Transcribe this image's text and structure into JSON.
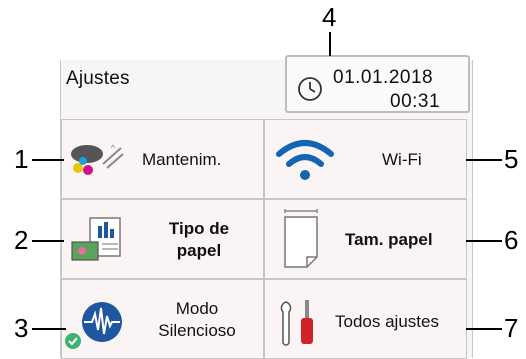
{
  "header": {
    "title": "Ajustes",
    "date": "01.01.2018",
    "time": "00:31"
  },
  "tiles": [
    {
      "label": "Mantenim.",
      "icon": "maintenance-icon"
    },
    {
      "label": "Wi-Fi",
      "icon": "wifi-icon"
    },
    {
      "label": "Tipo de papel",
      "line1": "Tipo de",
      "line2": "papel",
      "icon": "paper-type-icon"
    },
    {
      "label": "Tam. papel",
      "icon": "paper-size-icon"
    },
    {
      "label": "Modo Silencioso",
      "line1": "Modo",
      "line2": "Silencioso",
      "icon": "quiet-mode-icon"
    },
    {
      "label": "Todos ajustes",
      "icon": "tools-icon"
    }
  ],
  "callouts": [
    "1",
    "2",
    "3",
    "4",
    "5",
    "6",
    "7"
  ],
  "colors": {
    "wifi": "#1464b4",
    "quiet_wave": "#1e56a0",
    "check": "#3cb371"
  }
}
